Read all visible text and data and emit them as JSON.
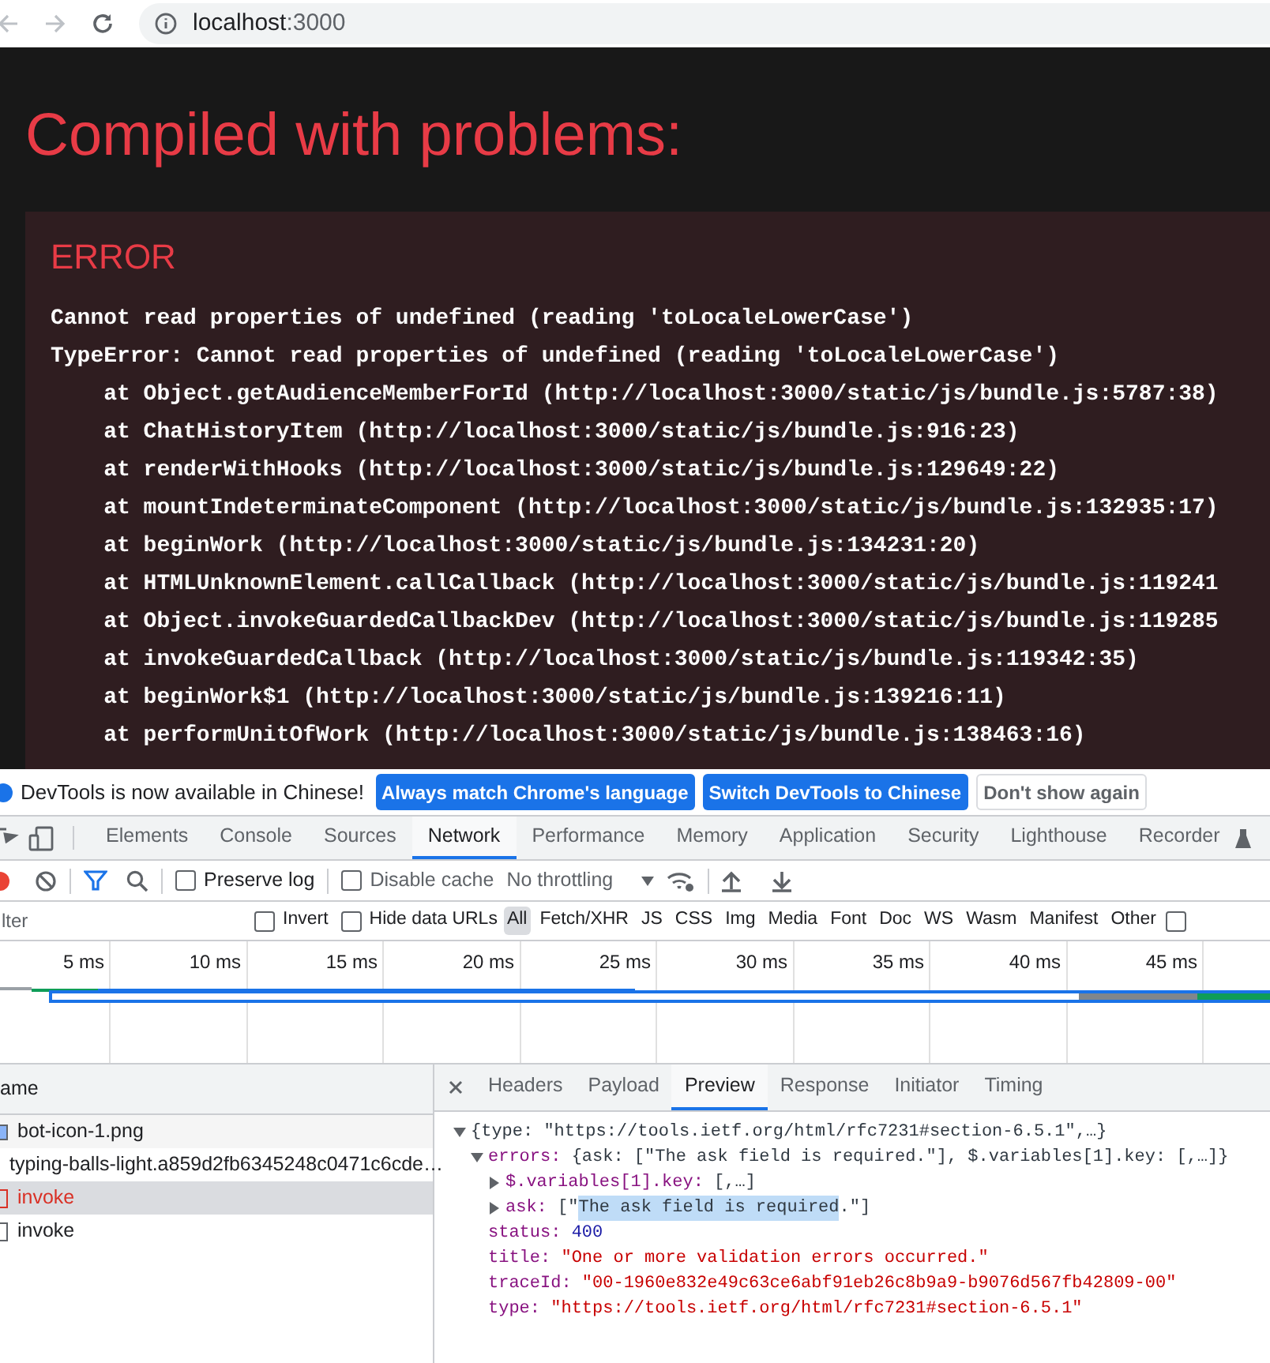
{
  "browser": {
    "url_host": "localhost",
    "url_port": ":3000"
  },
  "overlay": {
    "title": "Compiled with problems:",
    "error_label": "ERROR",
    "message": "Cannot read properties of undefined (reading 'toLocaleLowerCase')",
    "stack": [
      "TypeError: Cannot read properties of undefined (reading 'toLocaleLowerCase')",
      "    at Object.getAudienceMemberForId (http://localhost:3000/static/js/bundle.js:5787:38)",
      "    at ChatHistoryItem (http://localhost:3000/static/js/bundle.js:916:23)",
      "    at renderWithHooks (http://localhost:3000/static/js/bundle.js:129649:22)",
      "    at mountIndeterminateComponent (http://localhost:3000/static/js/bundle.js:132935:17)",
      "    at beginWork (http://localhost:3000/static/js/bundle.js:134231:20)",
      "    at HTMLUnknownElement.callCallback (http://localhost:3000/static/js/bundle.js:119241",
      "    at Object.invokeGuardedCallbackDev (http://localhost:3000/static/js/bundle.js:119285",
      "    at invokeGuardedCallback (http://localhost:3000/static/js/bundle.js:119342:35)",
      "    at beginWork$1 (http://localhost:3000/static/js/bundle.js:139216:11)",
      "    at performUnitOfWork (http://localhost:3000/static/js/bundle.js:138463:16)"
    ]
  },
  "infobar": {
    "message": "DevTools is now available in Chinese!",
    "buttons": [
      {
        "label": "Always match Chrome's language",
        "primary": true
      },
      {
        "label": "Switch DevTools to Chinese",
        "primary": true
      },
      {
        "label": "Don't show again",
        "primary": false
      }
    ]
  },
  "panel_tabs": [
    {
      "label": "Elements",
      "selected": false
    },
    {
      "label": "Console",
      "selected": false
    },
    {
      "label": "Sources",
      "selected": false
    },
    {
      "label": "Network",
      "selected": true
    },
    {
      "label": "Performance",
      "selected": false
    },
    {
      "label": "Memory",
      "selected": false
    },
    {
      "label": "Application",
      "selected": false
    },
    {
      "label": "Security",
      "selected": false
    },
    {
      "label": "Lighthouse",
      "selected": false
    },
    {
      "label": "Recorder",
      "selected": false
    }
  ],
  "toolbar": {
    "preserve_log": {
      "label": "Preserve log",
      "checked": false
    },
    "disable_cache": {
      "label": "Disable cache",
      "checked": false
    },
    "throttling": "No throttling"
  },
  "filter_bar": {
    "placeholder": "lter",
    "invert": {
      "label": "Invert",
      "checked": false
    },
    "hide_data_urls": {
      "label": "Hide data URLs",
      "checked": false
    },
    "types": [
      {
        "label": "All",
        "selected": true
      },
      {
        "label": "Fetch/XHR",
        "selected": false
      },
      {
        "label": "JS",
        "selected": false
      },
      {
        "label": "CSS",
        "selected": false
      },
      {
        "label": "Img",
        "selected": false
      },
      {
        "label": "Media",
        "selected": false
      },
      {
        "label": "Font",
        "selected": false
      },
      {
        "label": "Doc",
        "selected": false
      },
      {
        "label": "WS",
        "selected": false
      },
      {
        "label": "Wasm",
        "selected": false
      },
      {
        "label": "Manifest",
        "selected": false
      },
      {
        "label": "Other",
        "selected": false
      }
    ],
    "more_option": {
      "checked": false
    }
  },
  "timeline": {
    "ticks": [
      "5 ms",
      "10 ms",
      "15 ms",
      "20 ms",
      "25 ms",
      "30 ms",
      "35 ms",
      "40 ms",
      "45 ms"
    ]
  },
  "requests": {
    "column": "ame",
    "rows": [
      {
        "name": "bot-icon-1.png",
        "kind": "image",
        "error": false,
        "selected": false
      },
      {
        "name": "typing-balls-light.a859d2fb6345248c0471c6cde…",
        "kind": "plain",
        "error": false,
        "selected": false
      },
      {
        "name": "invoke",
        "kind": "doc",
        "error": true,
        "selected": true
      },
      {
        "name": "invoke",
        "kind": "doc",
        "error": false,
        "selected": false
      }
    ]
  },
  "detail_tabs": [
    {
      "label": "Headers",
      "selected": false
    },
    {
      "label": "Payload",
      "selected": false
    },
    {
      "label": "Preview",
      "selected": true
    },
    {
      "label": "Response",
      "selected": false
    },
    {
      "label": "Initiator",
      "selected": false
    },
    {
      "label": "Timing",
      "selected": false
    }
  ],
  "preview": [
    {
      "summary": "{type: \"https://tools.ietf.org/html/rfc7231#section-6.5.1\",…}",
      "expanded": true,
      "children": [
        {
          "key": "errors:",
          "summary": "{ask: [\"The ask field is required.\"], $.variables[1].key: [,…]}",
          "expanded": true,
          "children": [
            {
              "key": "$.variables[1].key:",
              "summary": "[,…]",
              "expanded": false
            },
            {
              "key": "ask:",
              "before": "[\"",
              "selected_text": "The ask field is required",
              "after": ".\"]",
              "expanded": false
            }
          ]
        },
        {
          "key": "status:",
          "value": "400",
          "kind": "number"
        },
        {
          "key": "title:",
          "value": "\"One or more validation errors occurred.\"",
          "kind": "string"
        },
        {
          "key": "traceId:",
          "value": "\"00-1960e832e49c63ce6abf91eb26c8b9a9-b9076d567fb42809-00\"",
          "kind": "string"
        },
        {
          "key": "type:",
          "value": "\"https://tools.ietf.org/html/rfc7231#section-6.5.1\"",
          "kind": "string"
        }
      ]
    }
  ]
}
